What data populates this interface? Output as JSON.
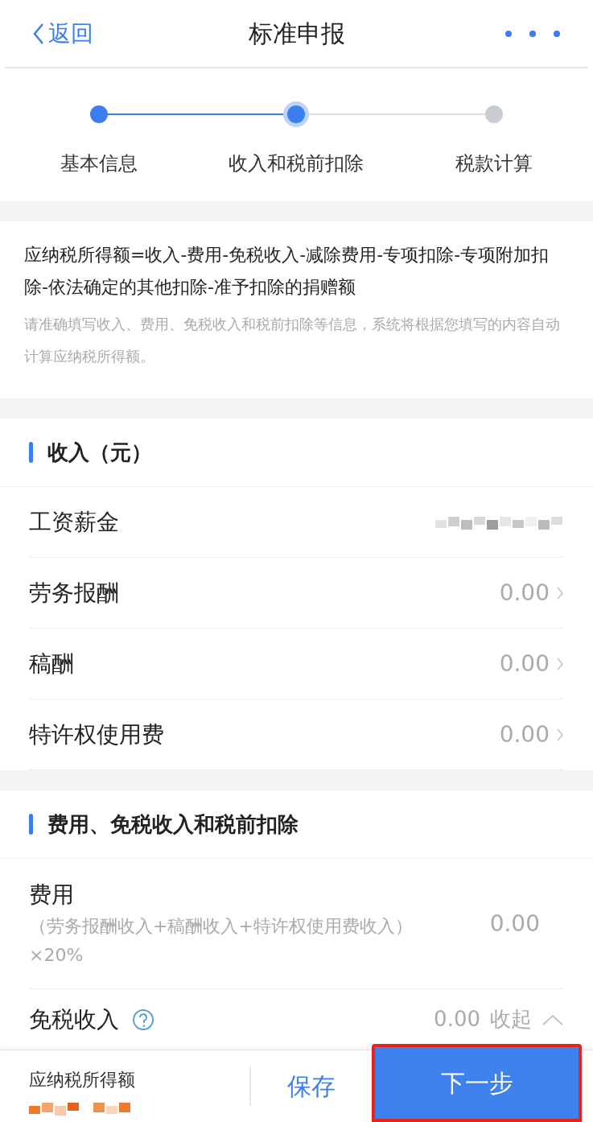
{
  "nav": {
    "back": "返回",
    "title": "标准申报"
  },
  "steps": [
    {
      "label": "基本信息",
      "done": true,
      "selected": false
    },
    {
      "label": "收入和税前扣除",
      "done": true,
      "selected": true
    },
    {
      "label": "税款计算",
      "done": false,
      "selected": false
    }
  ],
  "intro": {
    "formula": "应纳税所得额=收入-费用-免税收入-减除费用-专项扣除-专项附加扣除-依法确定的其他扣除-准予扣除的捐赠额",
    "note": "请准确填写收入、费用、免税收入和税前扣除等信息，系统将根据您填写的内容自动计算应纳税所得额。"
  },
  "income": {
    "title": "收入（元）",
    "rows": [
      {
        "label": "工资薪金",
        "kind": "redacted"
      },
      {
        "label": "劳务报酬",
        "kind": "amount",
        "value": "0.00"
      },
      {
        "label": "稿酬",
        "kind": "amount",
        "value": "0.00"
      },
      {
        "label": "特许权使用费",
        "kind": "amount",
        "value": "0.00"
      }
    ]
  },
  "deductions": {
    "title": "费用、免税收入和税前扣除",
    "expense": {
      "label": "费用",
      "formula": "（劳务报酬收入+稿酬收入+特许权使用费收入）×20%",
      "value": "0.00"
    },
    "exempt": {
      "label": "免税收入",
      "value": "0.00",
      "toggle": "收起",
      "expanded": true
    }
  },
  "footer": {
    "label": "应纳税所得额",
    "save": "保存",
    "next": "下一步",
    "highlighted": true
  }
}
